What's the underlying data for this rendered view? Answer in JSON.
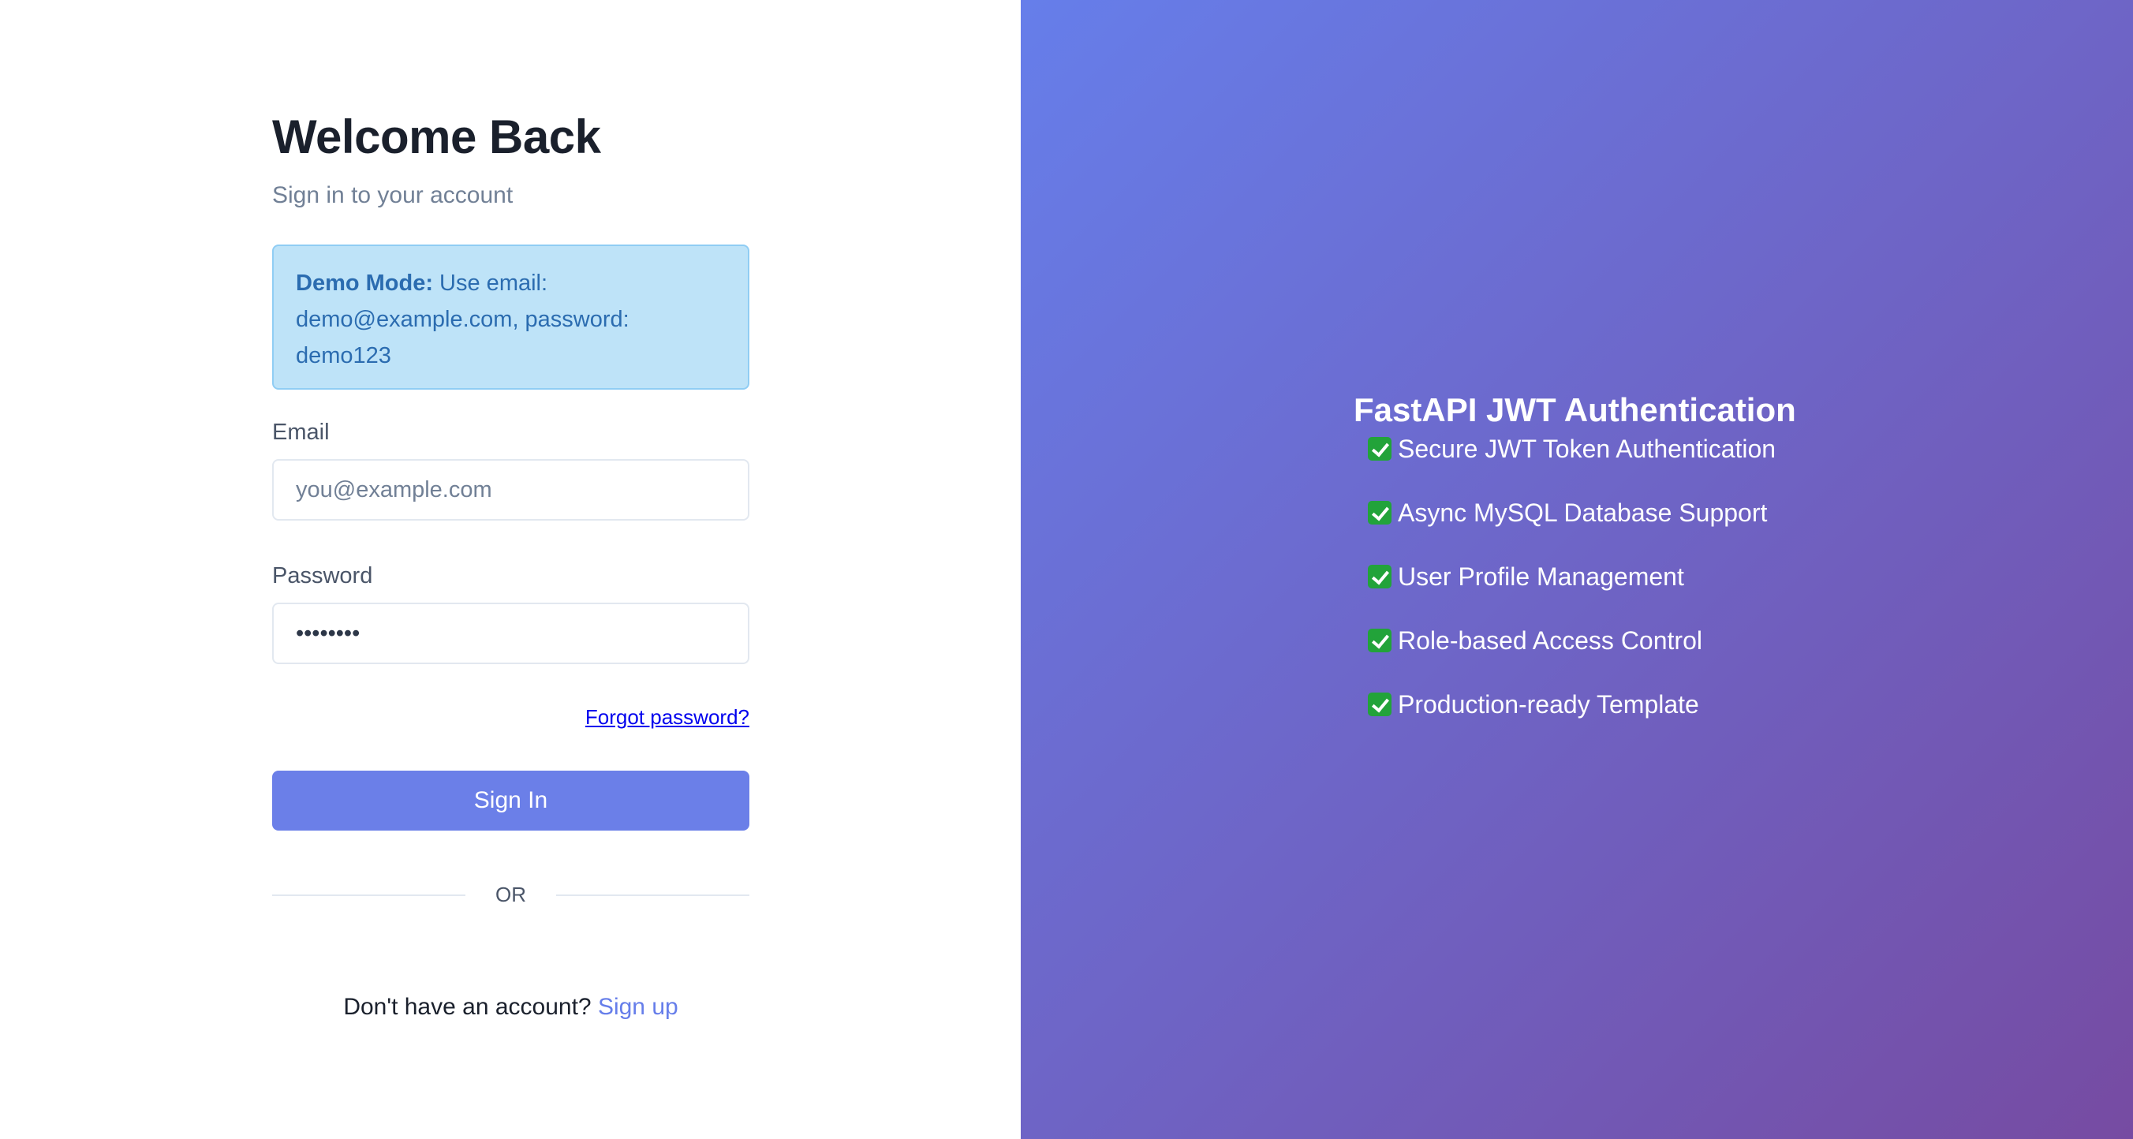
{
  "login": {
    "title": "Welcome Back",
    "subtitle": "Sign in to your account",
    "demo": {
      "label": "Demo Mode:",
      "text": " Use email: demo@example.com, password: demo123"
    },
    "email": {
      "label": "Email",
      "placeholder": "you@example.com",
      "value": ""
    },
    "password": {
      "label": "Password",
      "value": "••••••••"
    },
    "forgot_link": "Forgot password?",
    "signin_button": "Sign In",
    "divider_text": "OR",
    "signup_prompt": "Don't have an account? ",
    "signup_link": "Sign up"
  },
  "features": {
    "title": "FastAPI JWT Authentication",
    "icon": "check-mark-button-icon",
    "items": [
      "Secure JWT Token Authentication",
      "Async MySQL Database Support",
      "User Profile Management",
      "Role-based Access Control",
      "Production-ready Template"
    ]
  },
  "colors": {
    "primary_button": "#6b7fe8",
    "gradient_start": "#667eea",
    "gradient_end": "#764ba2",
    "demo_background": "#bee3f8",
    "demo_text": "#2b6cb0",
    "link": "#0000ee",
    "signup_link": "#667eea",
    "check_icon": "#22a33a"
  }
}
